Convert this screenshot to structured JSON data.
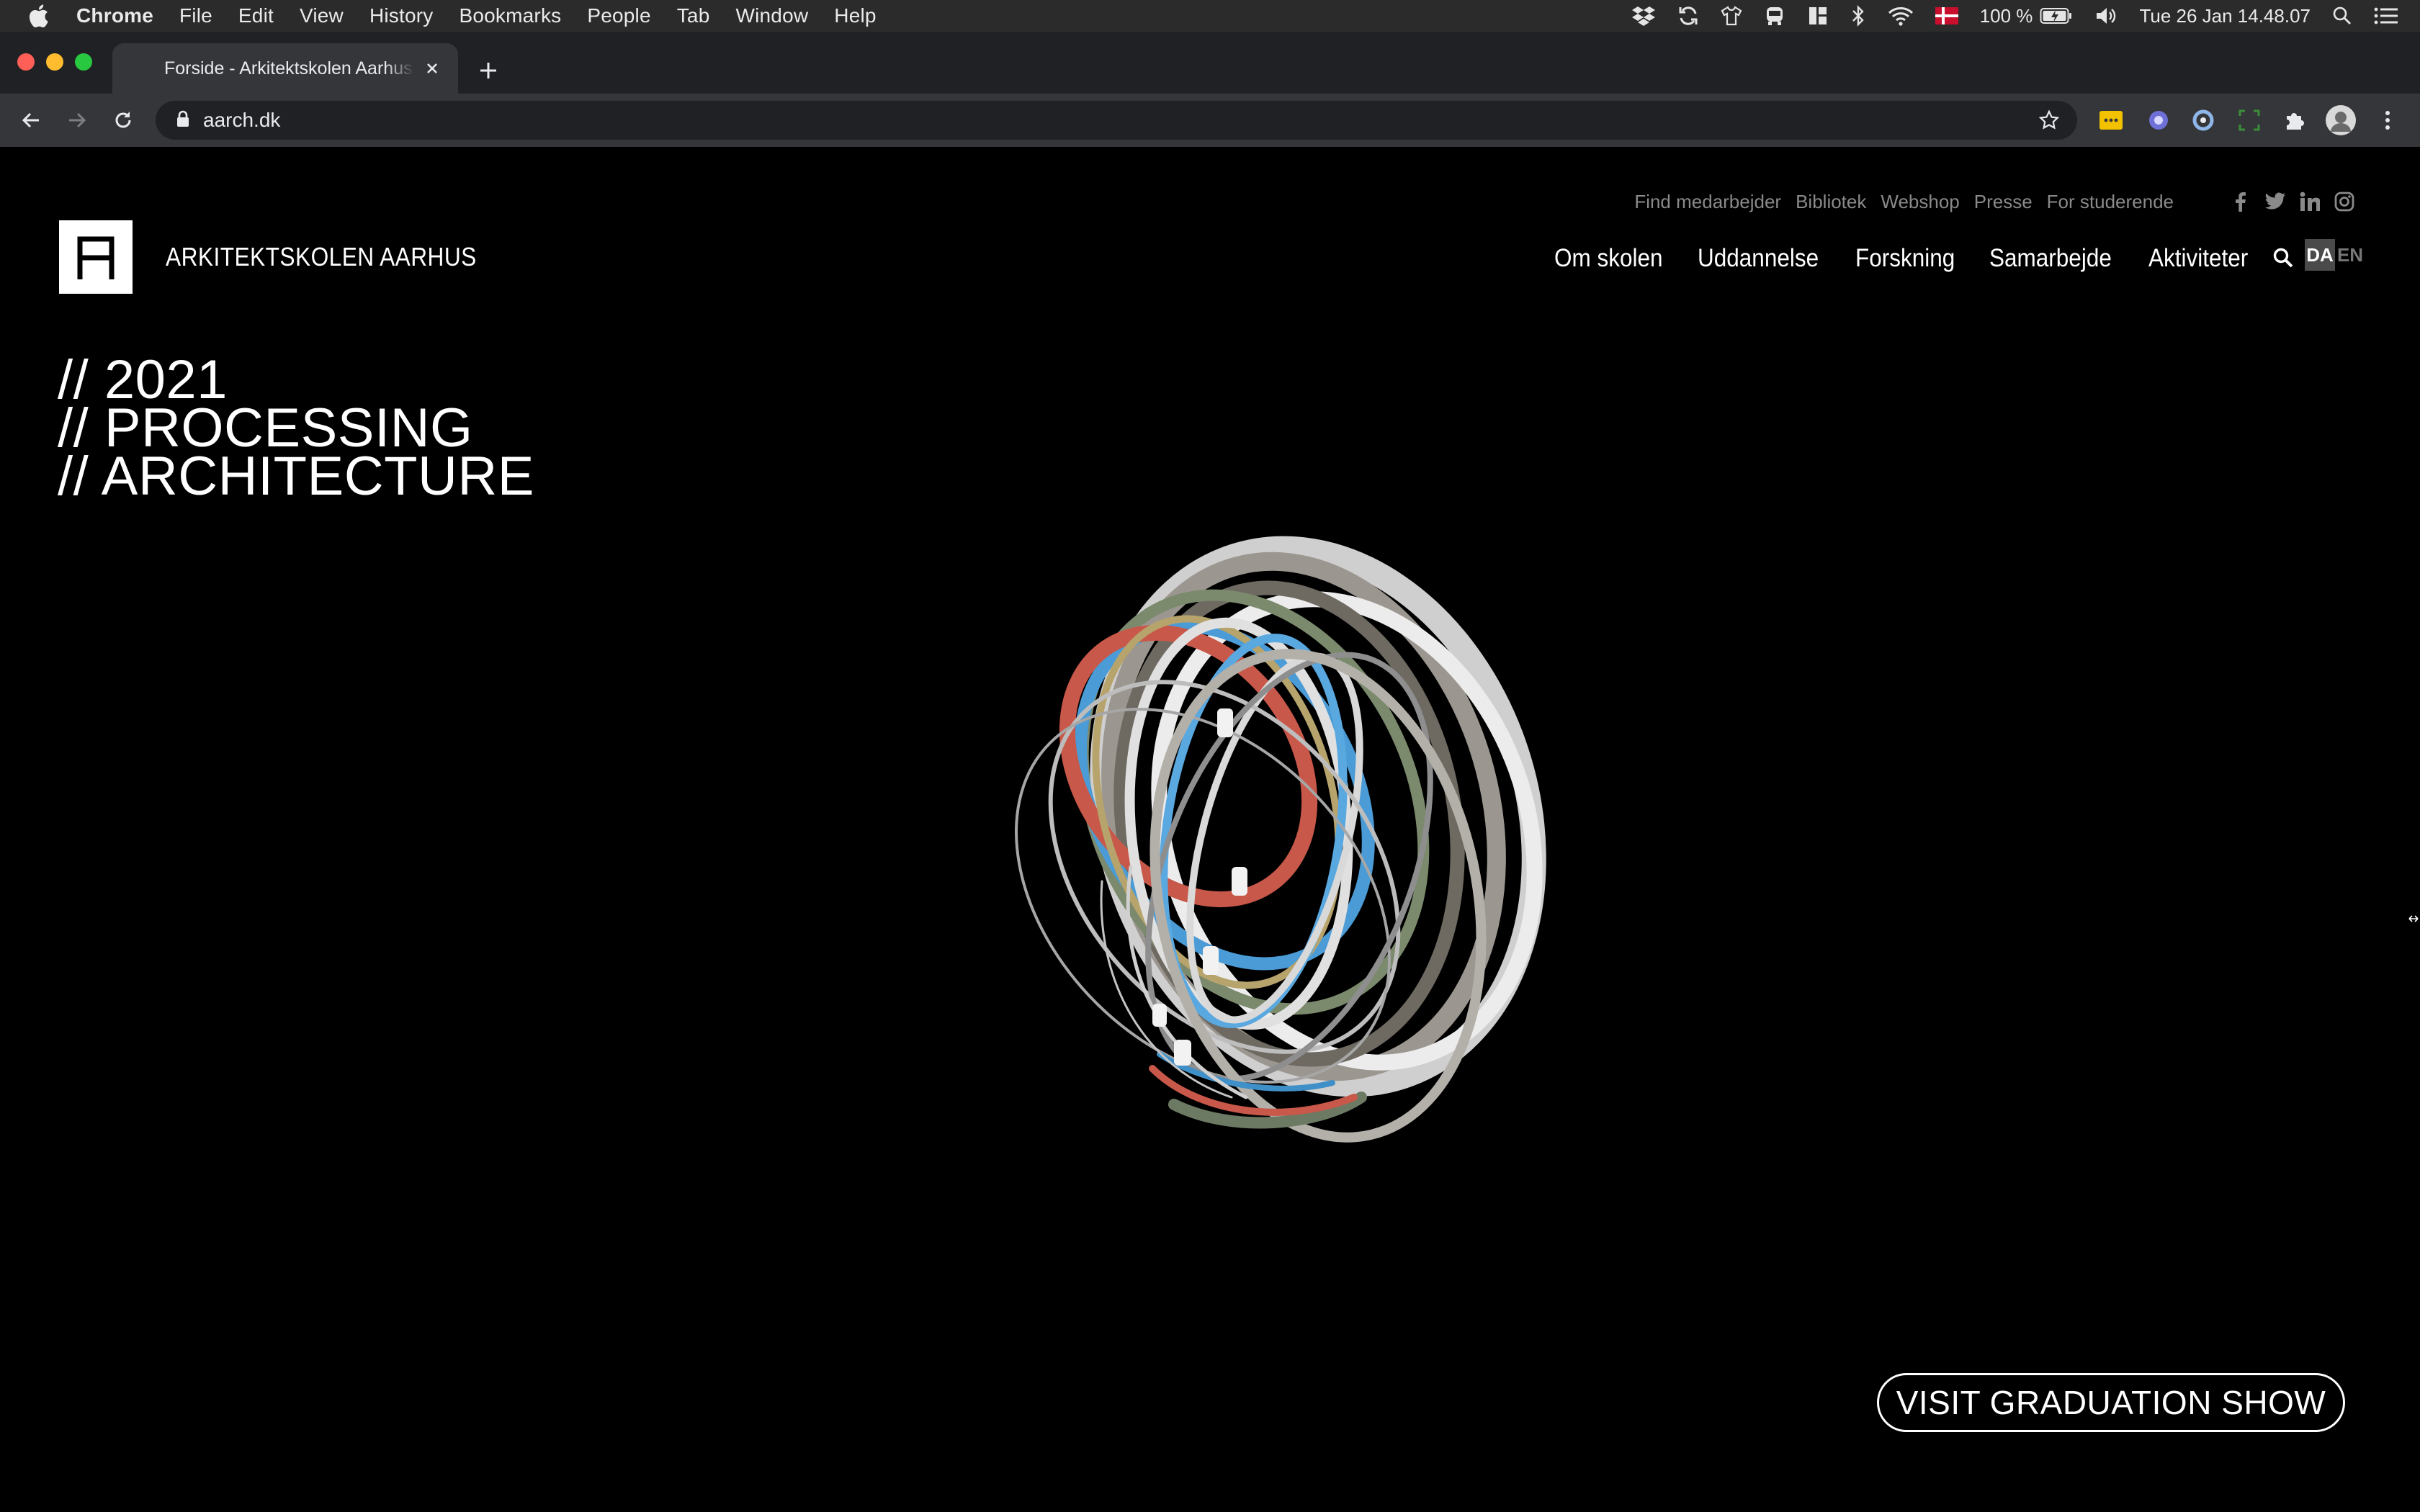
{
  "menubar": {
    "app_name": "Chrome",
    "menus": [
      "File",
      "Edit",
      "View",
      "History",
      "Bookmarks",
      "People",
      "Tab",
      "Window",
      "Help"
    ],
    "battery": "100 %",
    "datetime": "Tue 26 Jan  14.48.07"
  },
  "browser": {
    "tab_title": "Forside - Arkitektskolen Aarhus",
    "url": "aarch.dk"
  },
  "site": {
    "brand": "ARKITEKTSKOLEN AARHUS",
    "utility_links": [
      "Find medarbejder",
      "Bibliotek",
      "Webshop",
      "Presse",
      "For studerende"
    ],
    "social_icons": [
      "facebook-icon",
      "twitter-icon",
      "linkedin-icon",
      "instagram-icon"
    ],
    "main_nav": [
      "Om skolen",
      "Uddannelse",
      "Forskning",
      "Samarbejde",
      "Aktiviteter"
    ],
    "lang_active": "DA",
    "lang_other": "EN",
    "headline": [
      "// 2021",
      "// PROCESSING",
      "// ARCHITECTURE"
    ],
    "cta_label": "VISIT GRADUATION SHOW"
  },
  "colors": {
    "page_bg": "#000000",
    "menubar_bg": "#2b2b2c",
    "tabstrip_bg": "#202124",
    "toolbar_bg": "#35363a",
    "utility_link": "#8a8a8a"
  }
}
